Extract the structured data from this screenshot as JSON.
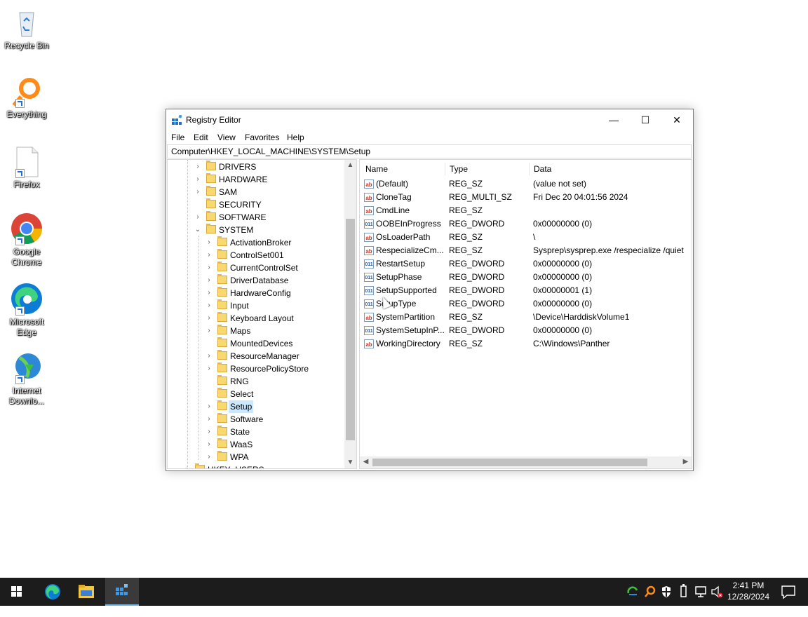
{
  "desktop": {
    "icons": [
      {
        "label": "Recycle Bin"
      },
      {
        "label": "Everything"
      },
      {
        "label": "Firefox"
      },
      {
        "label": "Google Chrome"
      },
      {
        "label": "Microsoft Edge"
      },
      {
        "label": "Internet Downlo..."
      }
    ]
  },
  "window": {
    "title": "Registry Editor",
    "controls": {
      "minimize": "—",
      "maximize": "☐",
      "close": "✕"
    },
    "menu": [
      "File",
      "Edit",
      "View",
      "Favorites",
      "Help"
    ],
    "address": "Computer\\HKEY_LOCAL_MACHINE\\SYSTEM\\Setup"
  },
  "tree": {
    "items": [
      {
        "label": "DRIVERS",
        "chevron": "›"
      },
      {
        "label": "HARDWARE",
        "chevron": "›"
      },
      {
        "label": "SAM",
        "chevron": "›"
      },
      {
        "label": "SECURITY",
        "chevron": ""
      },
      {
        "label": "SOFTWARE",
        "chevron": "›"
      },
      {
        "label": "SYSTEM",
        "chevron": "⌄"
      },
      {
        "label": "ActivationBroker",
        "chevron": "›"
      },
      {
        "label": "ControlSet001",
        "chevron": "›"
      },
      {
        "label": "CurrentControlSet",
        "chevron": "›"
      },
      {
        "label": "DriverDatabase",
        "chevron": "›"
      },
      {
        "label": "HardwareConfig",
        "chevron": "›"
      },
      {
        "label": "Input",
        "chevron": "›"
      },
      {
        "label": "Keyboard Layout",
        "chevron": "›"
      },
      {
        "label": "Maps",
        "chevron": "›"
      },
      {
        "label": "MountedDevices",
        "chevron": ""
      },
      {
        "label": "ResourceManager",
        "chevron": "›"
      },
      {
        "label": "ResourcePolicyStore",
        "chevron": "›"
      },
      {
        "label": "RNG",
        "chevron": ""
      },
      {
        "label": "Select",
        "chevron": ""
      },
      {
        "label": "Setup",
        "chevron": "›"
      },
      {
        "label": "Software",
        "chevron": "›"
      },
      {
        "label": "State",
        "chevron": "›"
      },
      {
        "label": "WaaS",
        "chevron": "›"
      },
      {
        "label": "WPA",
        "chevron": "›"
      },
      {
        "label": "HKEY_USERS",
        "chevron": "›"
      }
    ],
    "selected": "Setup"
  },
  "values": {
    "columns": [
      "Name",
      "Type",
      "Data"
    ],
    "rows": [
      {
        "icon": "ab",
        "name": "(Default)",
        "type": "REG_SZ",
        "data": "(value not set)"
      },
      {
        "icon": "ab",
        "name": "CloneTag",
        "type": "REG_MULTI_SZ",
        "data": "Fri Dec 20 04:01:56 2024"
      },
      {
        "icon": "ab",
        "name": "CmdLine",
        "type": "REG_SZ",
        "data": ""
      },
      {
        "icon": "011",
        "name": "OOBEInProgress",
        "type": "REG_DWORD",
        "data": "0x00000000 (0)"
      },
      {
        "icon": "ab",
        "name": "OsLoaderPath",
        "type": "REG_SZ",
        "data": "\\"
      },
      {
        "icon": "ab",
        "name": "RespecializeCm...",
        "type": "REG_SZ",
        "data": "Sysprep\\sysprep.exe /respecialize /quiet"
      },
      {
        "icon": "011",
        "name": "RestartSetup",
        "type": "REG_DWORD",
        "data": "0x00000000 (0)"
      },
      {
        "icon": "011",
        "name": "SetupPhase",
        "type": "REG_DWORD",
        "data": "0x00000000 (0)"
      },
      {
        "icon": "011",
        "name": "SetupSupported",
        "type": "REG_DWORD",
        "data": "0x00000001 (1)"
      },
      {
        "icon": "011",
        "name": "SetupType",
        "type": "REG_DWORD",
        "data": "0x00000000 (0)"
      },
      {
        "icon": "ab",
        "name": "SystemPartition",
        "type": "REG_SZ",
        "data": "\\Device\\HarddiskVolume1"
      },
      {
        "icon": "011",
        "name": "SystemSetupInP...",
        "type": "REG_DWORD",
        "data": "0x00000000 (0)"
      },
      {
        "icon": "ab",
        "name": "WorkingDirectory",
        "type": "REG_SZ",
        "data": "C:\\Windows\\Panther"
      }
    ]
  },
  "taskbar": {
    "time": "2:41 PM",
    "date": "12/28/2024"
  },
  "colors": {
    "taskbar": "#1c1c1c",
    "selection": "#cce8ff",
    "folder": "#f9d872"
  }
}
